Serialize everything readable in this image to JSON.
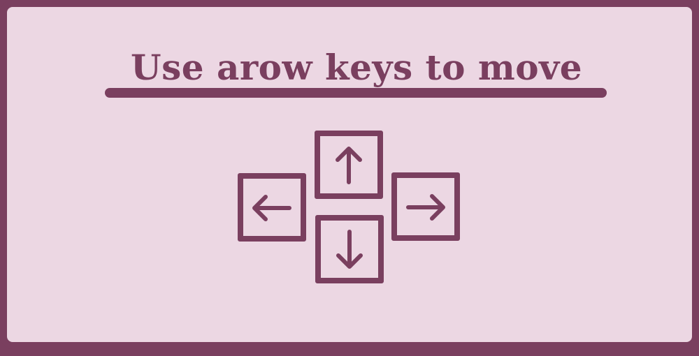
{
  "screen": {
    "title": "Use arow keys to move"
  },
  "keys": [
    {
      "id": "up",
      "icon": "arrow-up-icon"
    },
    {
      "id": "left",
      "icon": "arrow-left-icon"
    },
    {
      "id": "down",
      "icon": "arrow-down-icon"
    },
    {
      "id": "right",
      "icon": "arrow-right-icon"
    }
  ],
  "colors": {
    "background": "#ecd7e3",
    "accent": "#7a3f5f"
  }
}
